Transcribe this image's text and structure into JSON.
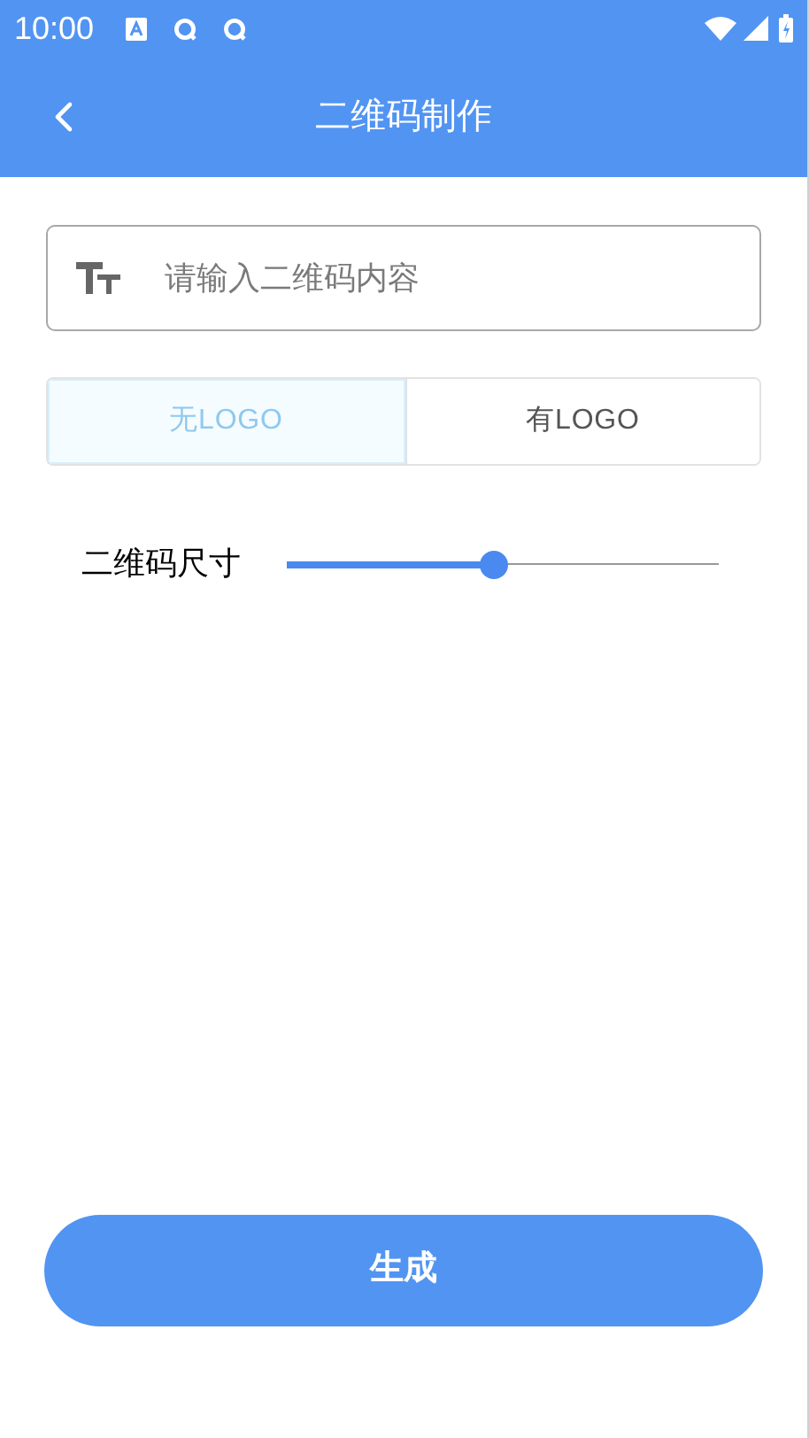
{
  "status_bar": {
    "time": "10:00"
  },
  "toolbar": {
    "title": "二维码制作"
  },
  "content_field": {
    "placeholder": "请输入二维码内容"
  },
  "logo_options": [
    {
      "label": "无LOGO",
      "selected": true
    },
    {
      "label": "有LOGO",
      "selected": false
    }
  ],
  "size_slider": {
    "label": "二维码尺寸",
    "level": 0.48
  },
  "generate_button": {
    "label": "生成"
  }
}
